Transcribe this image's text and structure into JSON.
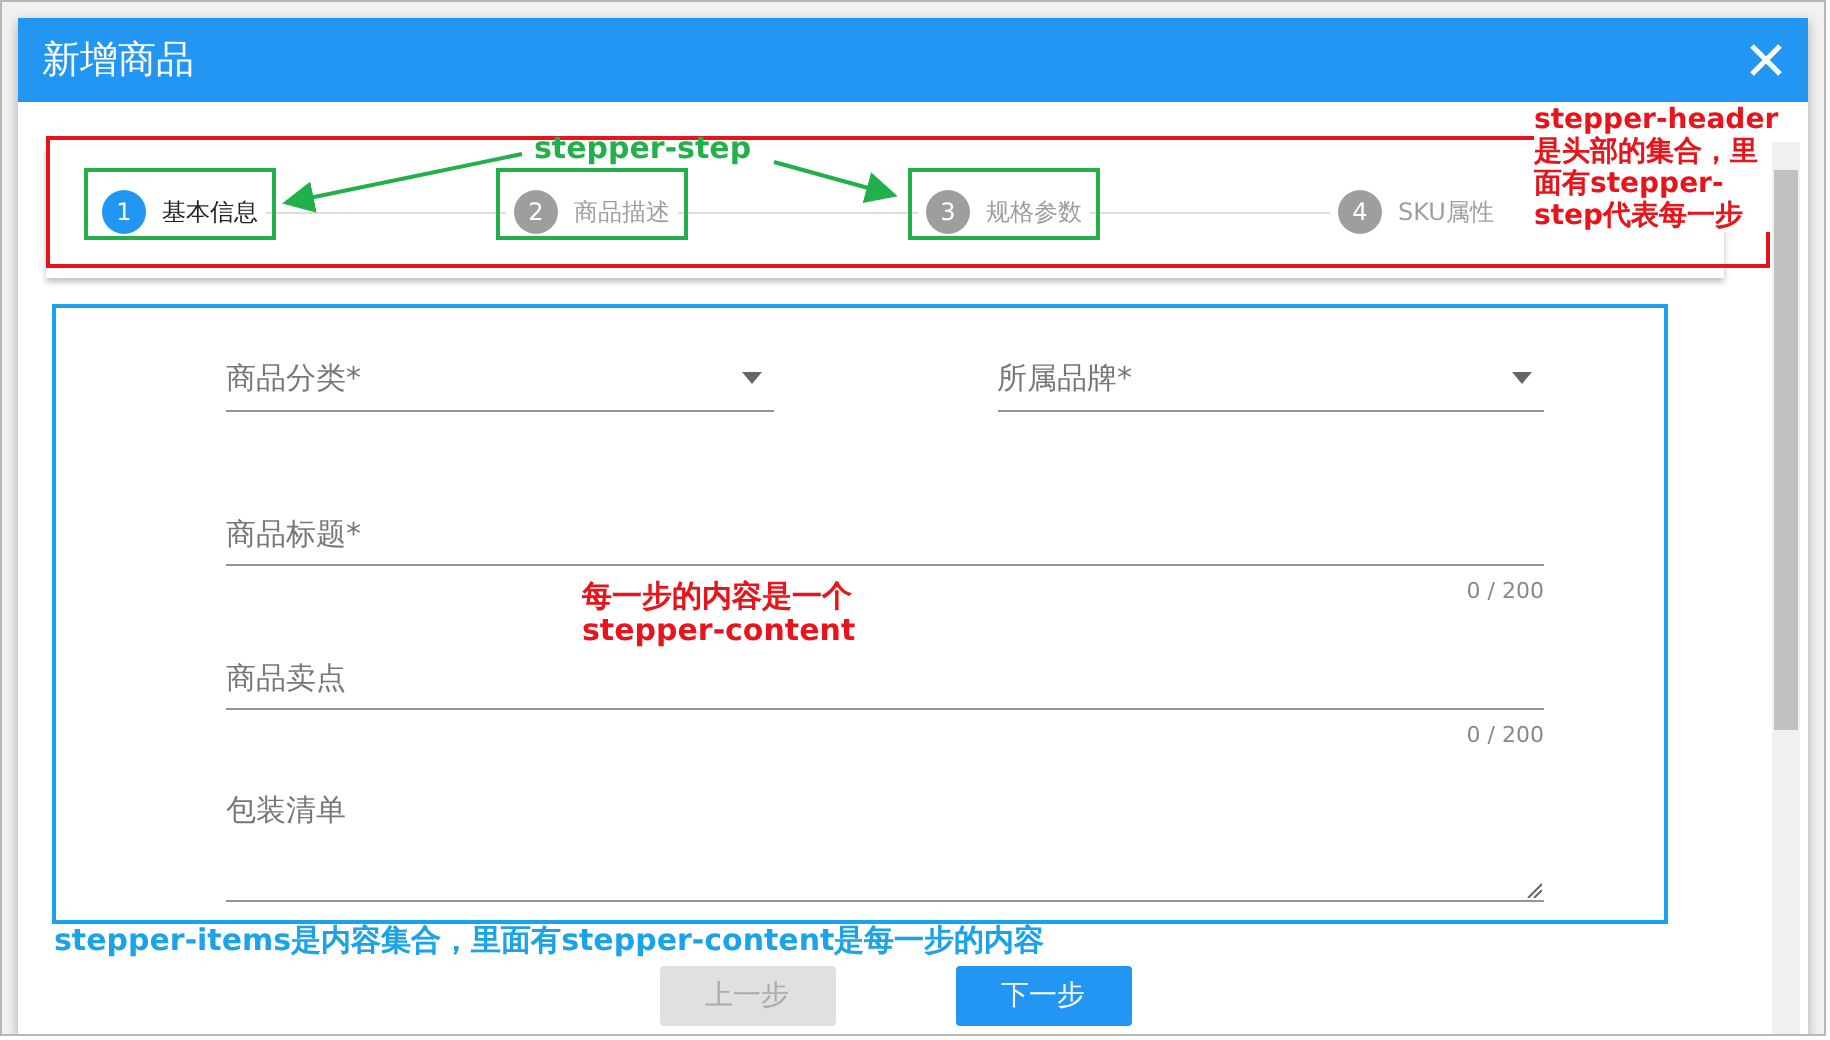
{
  "dialog": {
    "title": "新增商品"
  },
  "steps": [
    {
      "number": "1",
      "label": "基本信息",
      "selected": true
    },
    {
      "number": "2",
      "label": "商品描述",
      "selected": false
    },
    {
      "number": "3",
      "label": "规格参数",
      "selected": false
    },
    {
      "number": "4",
      "label": "SKU属性",
      "selected": false
    }
  ],
  "select_fields": [
    {
      "placeholder": "商品分类*"
    },
    {
      "placeholder": "所属品牌*"
    }
  ],
  "text_fields": [
    {
      "kind": "input",
      "placeholder": "商品标题*",
      "counter": "0 / 200"
    },
    {
      "kind": "input",
      "placeholder": "商品卖点",
      "counter": "0 / 200"
    },
    {
      "kind": "textarea",
      "placeholder": "包装清单"
    }
  ],
  "buttons": [
    {
      "label": "上一步",
      "disabled": true
    },
    {
      "label": "下一步",
      "disabled": false
    }
  ],
  "annotations": [
    {
      "kind": "step",
      "text": "stepper-step"
    },
    {
      "kind": "header",
      "text": "stepper-header是头部的集合，里面有stepper-step代表每一步"
    },
    {
      "kind": "content",
      "text": "每一步的内容是一个stepper-content"
    },
    {
      "kind": "items",
      "text": "stepper-items是内容集合，里面有stepper-content是每一步的内容"
    }
  ]
}
